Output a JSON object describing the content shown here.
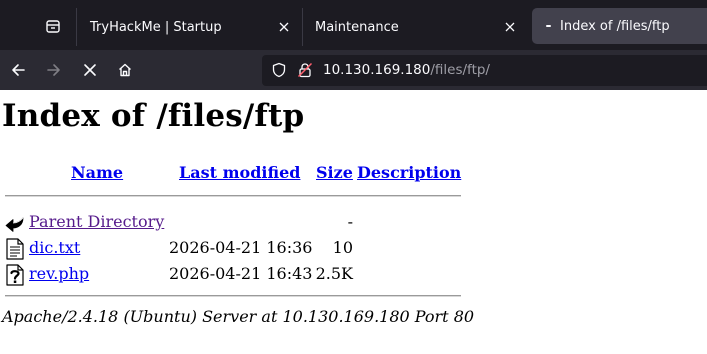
{
  "browser": {
    "tabs": [
      {
        "title": "TryHackMe | Startup",
        "active": false
      },
      {
        "title": "Maintenance",
        "active": false
      },
      {
        "title": "Index of /files/ftp",
        "active": true
      }
    ],
    "address": {
      "host": "10.130.169.180",
      "path": "/files/ftp/"
    },
    "colors": {
      "tabstrip": "#1c1b22",
      "toolbar": "#2b2a33",
      "active_tab": "#42414d",
      "url_text": "#fbfbfe",
      "url_path": "#9e9ea6"
    }
  },
  "page": {
    "title": "Index of /files/ftp",
    "columns": {
      "name": "Name",
      "last_modified": "Last modified",
      "size": "Size",
      "description": "Description"
    },
    "rows": [
      {
        "icon": "back-icon",
        "name": "Parent Directory",
        "date": "",
        "size": "-"
      },
      {
        "icon": "text-file-icon",
        "name": "dic.txt",
        "date": "2026-04-21 16:36",
        "size": "10"
      },
      {
        "icon": "unknown-file-icon",
        "name": "rev.php",
        "date": "2026-04-21 16:43",
        "size": "2.5K"
      }
    ],
    "footer": "Apache/2.4.18 (Ubuntu) Server at 10.130.169.180 Port 80"
  }
}
